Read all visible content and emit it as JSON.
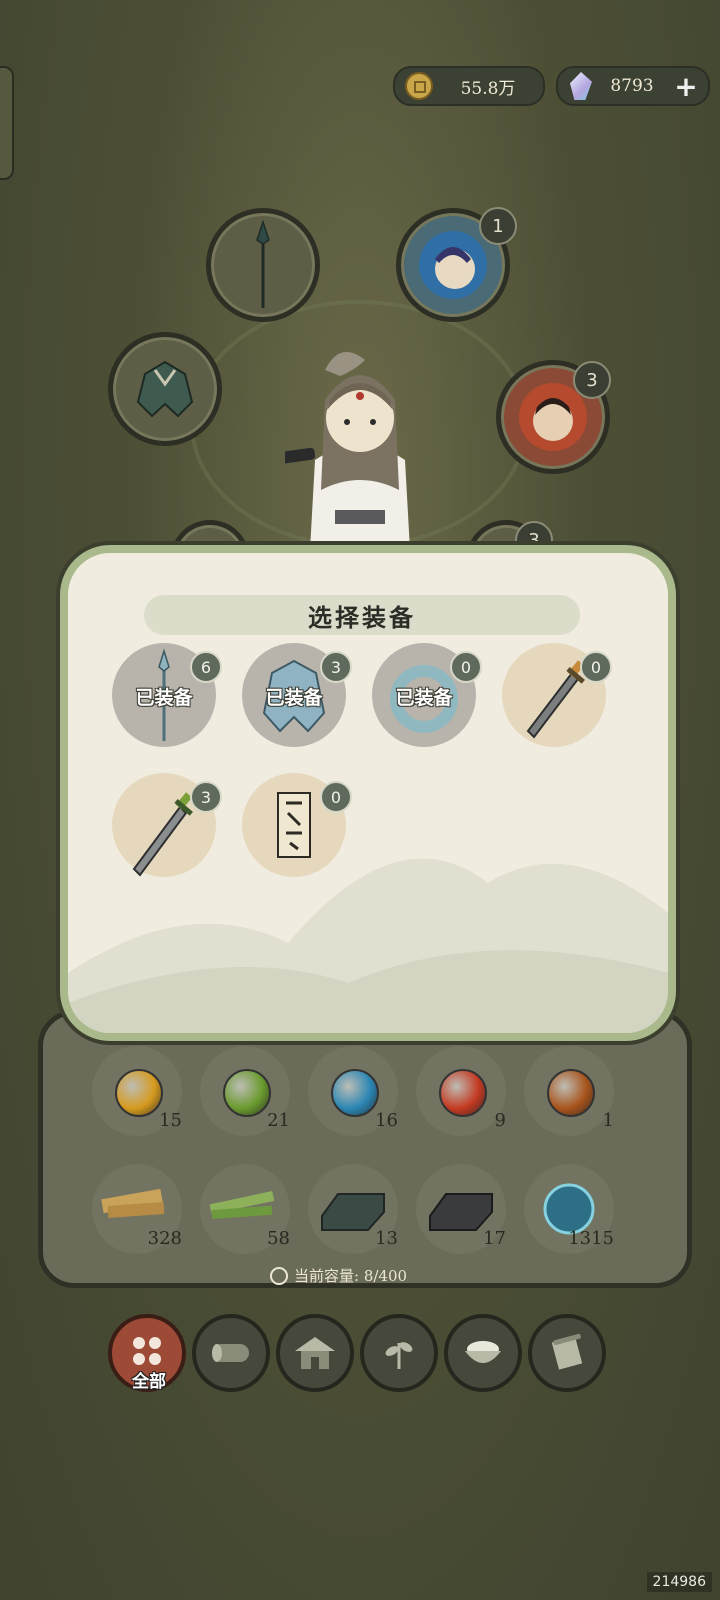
{
  "currency": {
    "coins": "55.8万",
    "gems": "8793",
    "add_label": "+"
  },
  "slots": {
    "weapon_slot_badge": "",
    "pet_slot_1_badge": "1",
    "pet_slot_2_badge": "3",
    "lower_right_badge": "3"
  },
  "dialog": {
    "title": "选择装备",
    "items": [
      {
        "icon": "spear-icon",
        "badge": "6",
        "status": "已装备"
      },
      {
        "icon": "armor-icon",
        "badge": "3",
        "status": "已装备"
      },
      {
        "icon": "ring-icon",
        "badge": "0",
        "status": "已装备"
      },
      {
        "icon": "sword-icon",
        "badge": "0",
        "status": ""
      },
      {
        "icon": "sword-green-icon",
        "badge": "3",
        "status": ""
      },
      {
        "icon": "talisman-icon",
        "badge": "0",
        "status": ""
      }
    ]
  },
  "inventory": {
    "row1": [
      {
        "icon": "yellow-orb-icon",
        "count": "15",
        "color": "#d59a1e"
      },
      {
        "icon": "green-orb-icon",
        "count": "21",
        "color": "#6a9a2e"
      },
      {
        "icon": "blue-orb-icon",
        "count": "16",
        "color": "#2b86b4"
      },
      {
        "icon": "red-orb-icon",
        "count": "9",
        "color": "#c43a22"
      },
      {
        "icon": "brown-orb-icon",
        "count": "1",
        "color": "#a8541b"
      }
    ],
    "row2": [
      {
        "icon": "wood-plank-icon",
        "count": "328"
      },
      {
        "icon": "bamboo-icon",
        "count": "58"
      },
      {
        "icon": "iron-ingot-icon",
        "count": "13"
      },
      {
        "icon": "dark-ingot-icon",
        "count": "17"
      },
      {
        "icon": "spirit-orb-icon",
        "count": "1315"
      }
    ],
    "capacity": "当前容量: 8/400"
  },
  "tabs": [
    {
      "icon": "grid-icon",
      "label": "全部",
      "active": true
    },
    {
      "icon": "log-icon",
      "label": ""
    },
    {
      "icon": "house-icon",
      "label": ""
    },
    {
      "icon": "herb-icon",
      "label": ""
    },
    {
      "icon": "rice-bowl-icon",
      "label": ""
    },
    {
      "icon": "scroll-icon",
      "label": ""
    }
  ],
  "watermark": "214986"
}
